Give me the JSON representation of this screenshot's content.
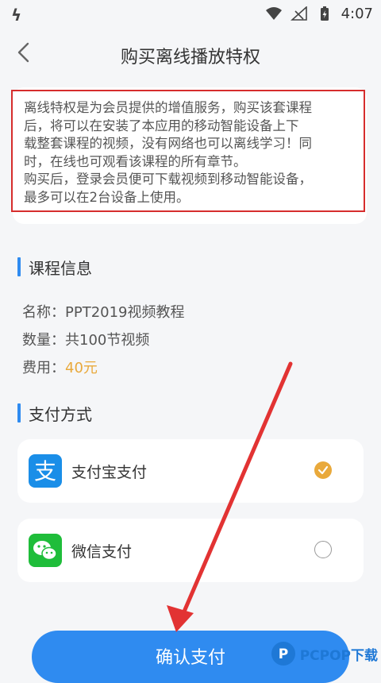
{
  "status_bar": {
    "time": "4:07",
    "left_icon": "bolt-logo-icon",
    "icons": [
      "wifi-icon",
      "signal-icon",
      "battery-charging-icon"
    ]
  },
  "header": {
    "back_icon": "back-arrow-icon",
    "title": "购买离线播放特权"
  },
  "notice": {
    "line1": "离线特权是为会员提供的增值服务，购买该套课程",
    "line2": "后，将可以在安装了本应用的移动智能设备上下",
    "line3": "载整套课程的视频，没有网络也可以离线学习！同",
    "line4": "时，在线也可观看该课程的所有章节。",
    "line5": "购买后，登录会员便可下载视频到移动智能设备，",
    "line6": "最多可以在2台设备上使用。"
  },
  "course_section": {
    "title": "课程信息",
    "name_label": "名称：",
    "name_value": "PPT2019视频教程",
    "count_label": "数量：",
    "count_value": "共100节视频",
    "fee_label": "费用：",
    "fee_value": "40元"
  },
  "payment_section": {
    "title": "支付方式",
    "options": [
      {
        "label": "支付宝支付",
        "icon": "alipay-icon",
        "selected": true
      },
      {
        "label": "微信支付",
        "icon": "wechat-icon",
        "selected": false
      }
    ]
  },
  "confirm_button": {
    "label": "确认支付"
  },
  "watermark": {
    "text": "PCPOP下载"
  },
  "colors": {
    "accent": "#2f8bf0",
    "price": "#e9a93b",
    "annotation": "#e23333",
    "alipay": "#1a8ee8",
    "wechat": "#1fbd3a"
  }
}
